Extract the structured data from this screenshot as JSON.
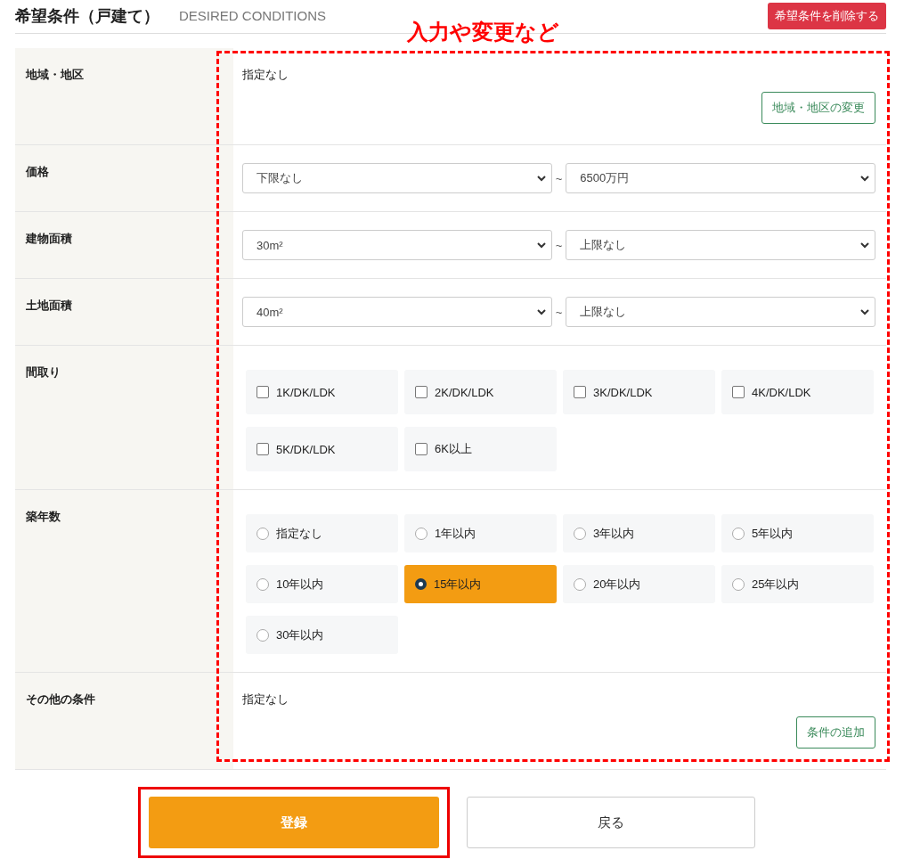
{
  "header": {
    "title": "希望条件（戸建て）",
    "subtitle": "DESIRED CONDITIONS",
    "delete_button": "希望条件を削除する"
  },
  "annotation": {
    "label": "入力や変更など"
  },
  "rows": [
    {
      "kind": "text",
      "label": "地域・地区",
      "value": "指定なし",
      "button": "地域・地区の変更"
    },
    {
      "kind": "range",
      "label": "価格",
      "from": "下限なし",
      "separator": "~",
      "to": "6500万円"
    },
    {
      "kind": "range",
      "label": "建物面積",
      "from": "30m²",
      "separator": "~",
      "to": "上限なし"
    },
    {
      "kind": "range",
      "label": "土地面積",
      "from": "40m²",
      "separator": "~",
      "to": "上限なし"
    },
    {
      "kind": "checkboxes",
      "label": "間取り",
      "options": [
        {
          "label": "1K/DK/LDK",
          "checked": false
        },
        {
          "label": "2K/DK/LDK",
          "checked": false
        },
        {
          "label": "3K/DK/LDK",
          "checked": false
        },
        {
          "label": "4K/DK/LDK",
          "checked": false
        },
        {
          "label": "5K/DK/LDK",
          "checked": false
        },
        {
          "label": "6K以上",
          "checked": false
        }
      ]
    },
    {
      "kind": "radios",
      "label": "築年数",
      "options": [
        {
          "label": "指定なし",
          "selected": false
        },
        {
          "label": "1年以内",
          "selected": false
        },
        {
          "label": "3年以内",
          "selected": false
        },
        {
          "label": "5年以内",
          "selected": false
        },
        {
          "label": "10年以内",
          "selected": false
        },
        {
          "label": "15年以内",
          "selected": true
        },
        {
          "label": "20年以内",
          "selected": false
        },
        {
          "label": "25年以内",
          "selected": false
        },
        {
          "label": "30年以内",
          "selected": false
        }
      ]
    },
    {
      "kind": "text",
      "label": "その他の条件",
      "value": "指定なし",
      "button": "条件の追加"
    }
  ],
  "actions": {
    "submit": "登録",
    "back": "戻る"
  }
}
